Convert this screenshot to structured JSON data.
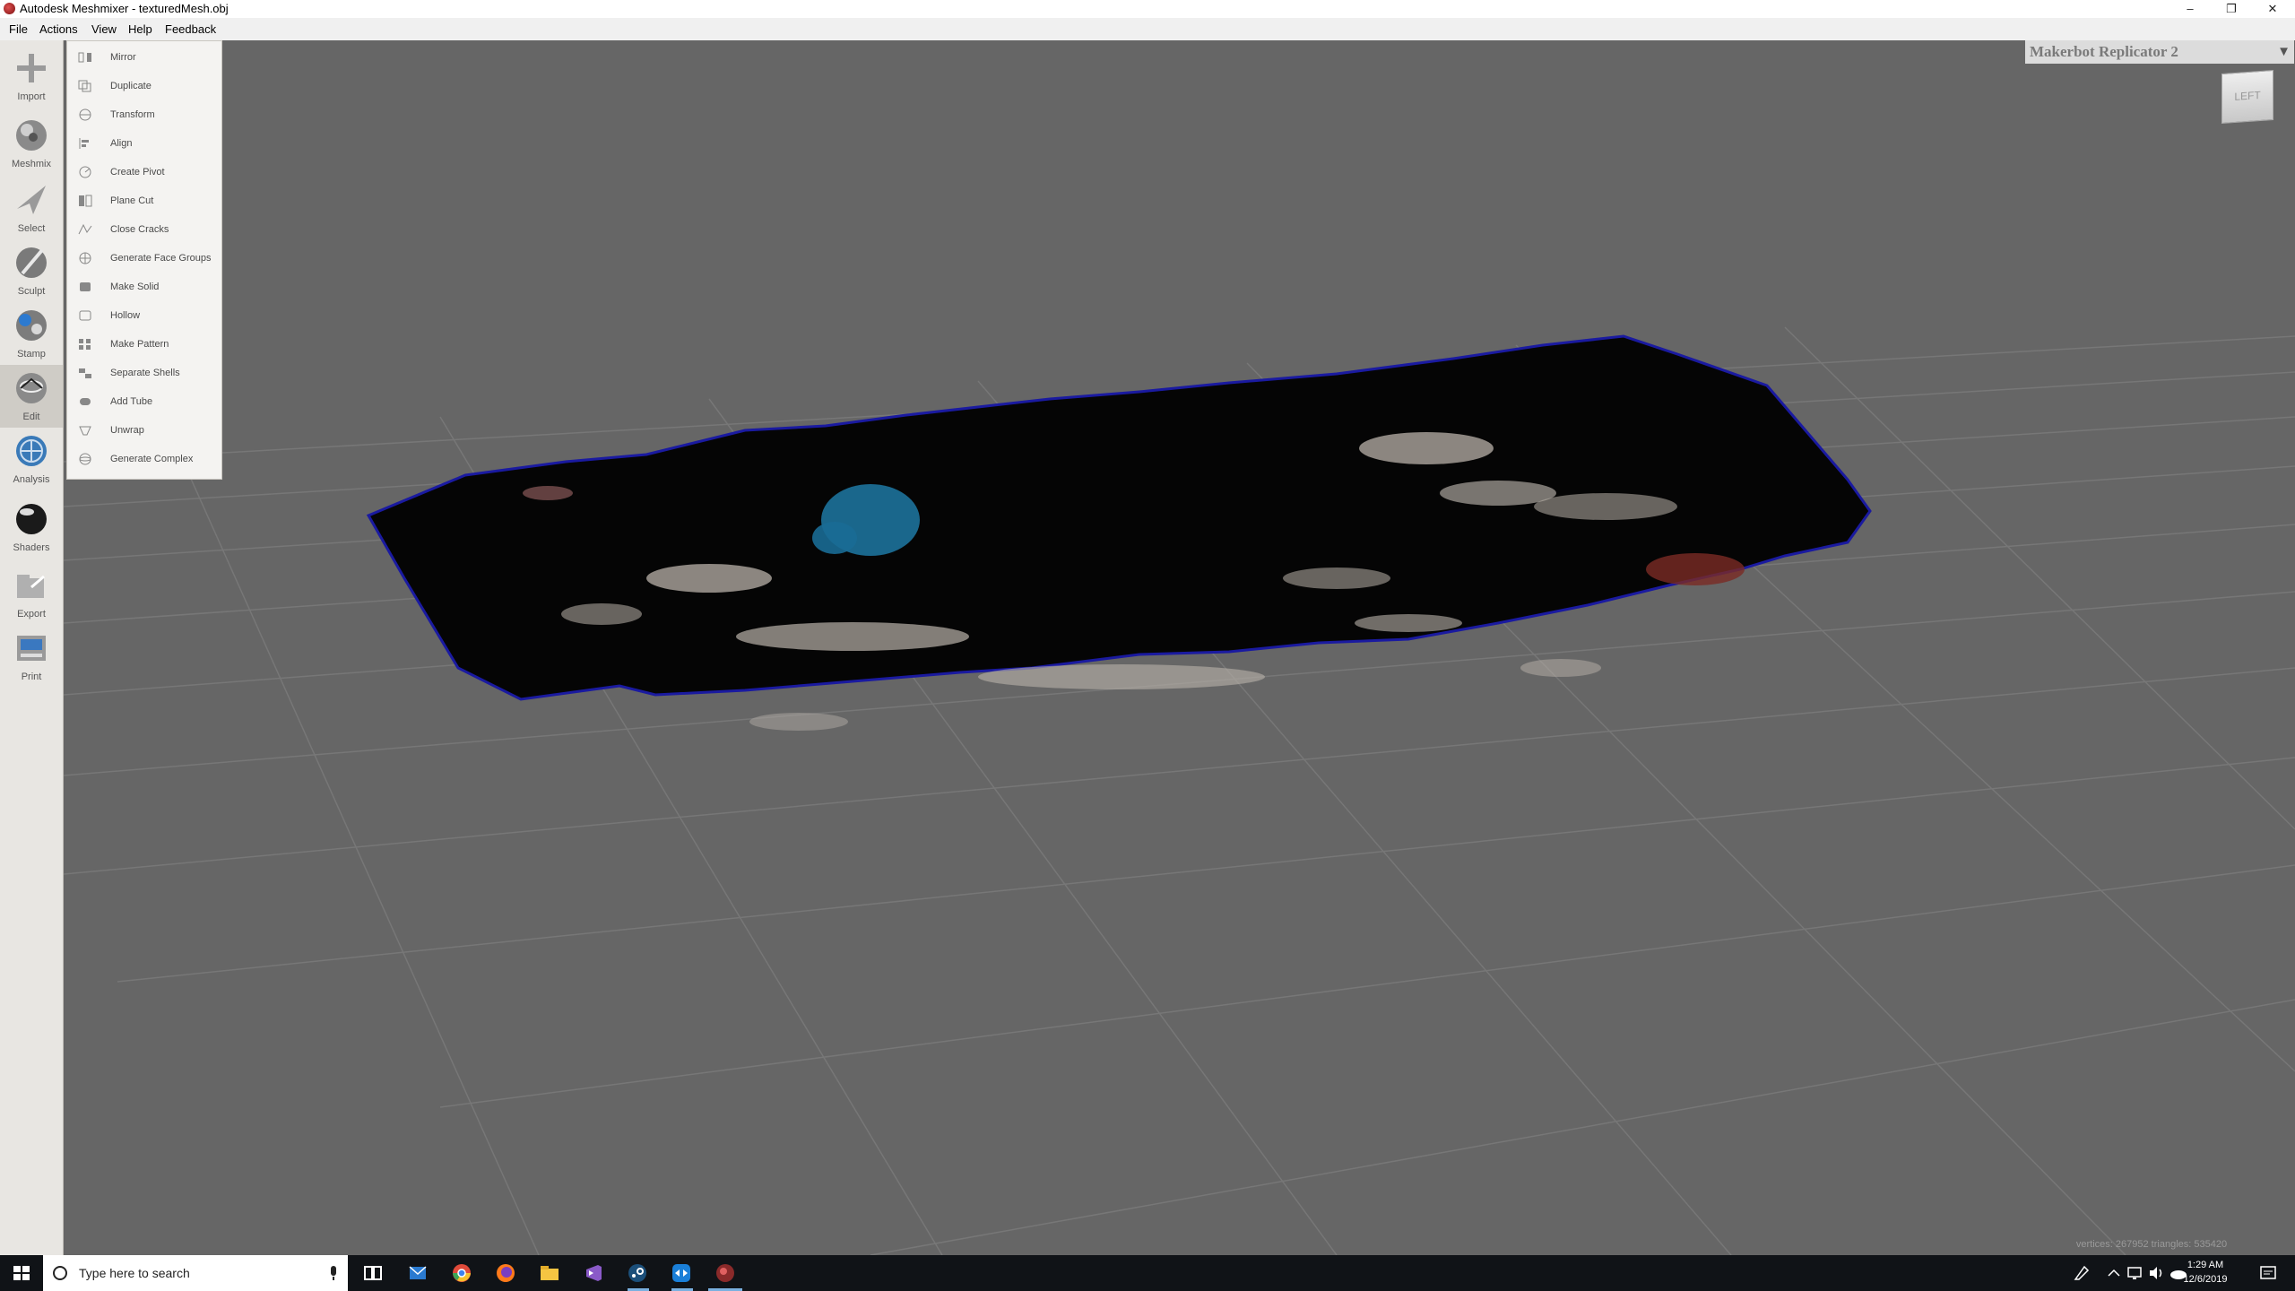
{
  "window": {
    "title": "Autodesk Meshmixer - texturedMesh.obj",
    "minimize": "–",
    "maximize": "❐",
    "close": "✕"
  },
  "menubar": {
    "items": [
      "File",
      "Actions",
      "View",
      "Help",
      "Feedback"
    ]
  },
  "toolbar": {
    "tools": [
      {
        "label": "Import",
        "icon": "plus-icon"
      },
      {
        "label": "Meshmix",
        "icon": "meshmix-sphere-icon"
      },
      {
        "label": "Select",
        "icon": "arrow-cursor-icon"
      },
      {
        "label": "Sculpt",
        "icon": "brush-icon"
      },
      {
        "label": "Stamp",
        "icon": "stamp-icon"
      },
      {
        "label": "Edit",
        "icon": "edit-sphere-icon",
        "active": true
      },
      {
        "label": "Analysis",
        "icon": "analysis-icon"
      },
      {
        "label": "Shaders",
        "icon": "shader-ball-icon"
      },
      {
        "label": "Export",
        "icon": "export-icon"
      },
      {
        "label": "Print",
        "icon": "printer-icon"
      }
    ]
  },
  "edit_menu": {
    "items": [
      "Mirror",
      "Duplicate",
      "Transform",
      "Align",
      "Create Pivot",
      "Plane Cut",
      "Close Cracks",
      "Generate Face Groups",
      "Make Solid",
      "Hollow",
      "Make Pattern",
      "Separate Shells",
      "Add Tube",
      "Unwrap",
      "Generate Complex"
    ]
  },
  "viewport": {
    "printer": "Makerbot Replicator 2",
    "dropdown_arrow": "▼",
    "viewcube_face": "LEFT",
    "stats": "vertices: 267952 triangles: 535420"
  },
  "taskbar": {
    "search_placeholder": "Type here to search",
    "clock_time": "1:29 AM",
    "clock_date": "12/6/2019"
  },
  "colors": {
    "background": "#666666",
    "mesh": "#050505",
    "mesh_edge": "#1a1aa0",
    "patch_light": "#b9b2aa",
    "patch_blue": "#1f7fae",
    "patch_red": "#7a2a24"
  }
}
